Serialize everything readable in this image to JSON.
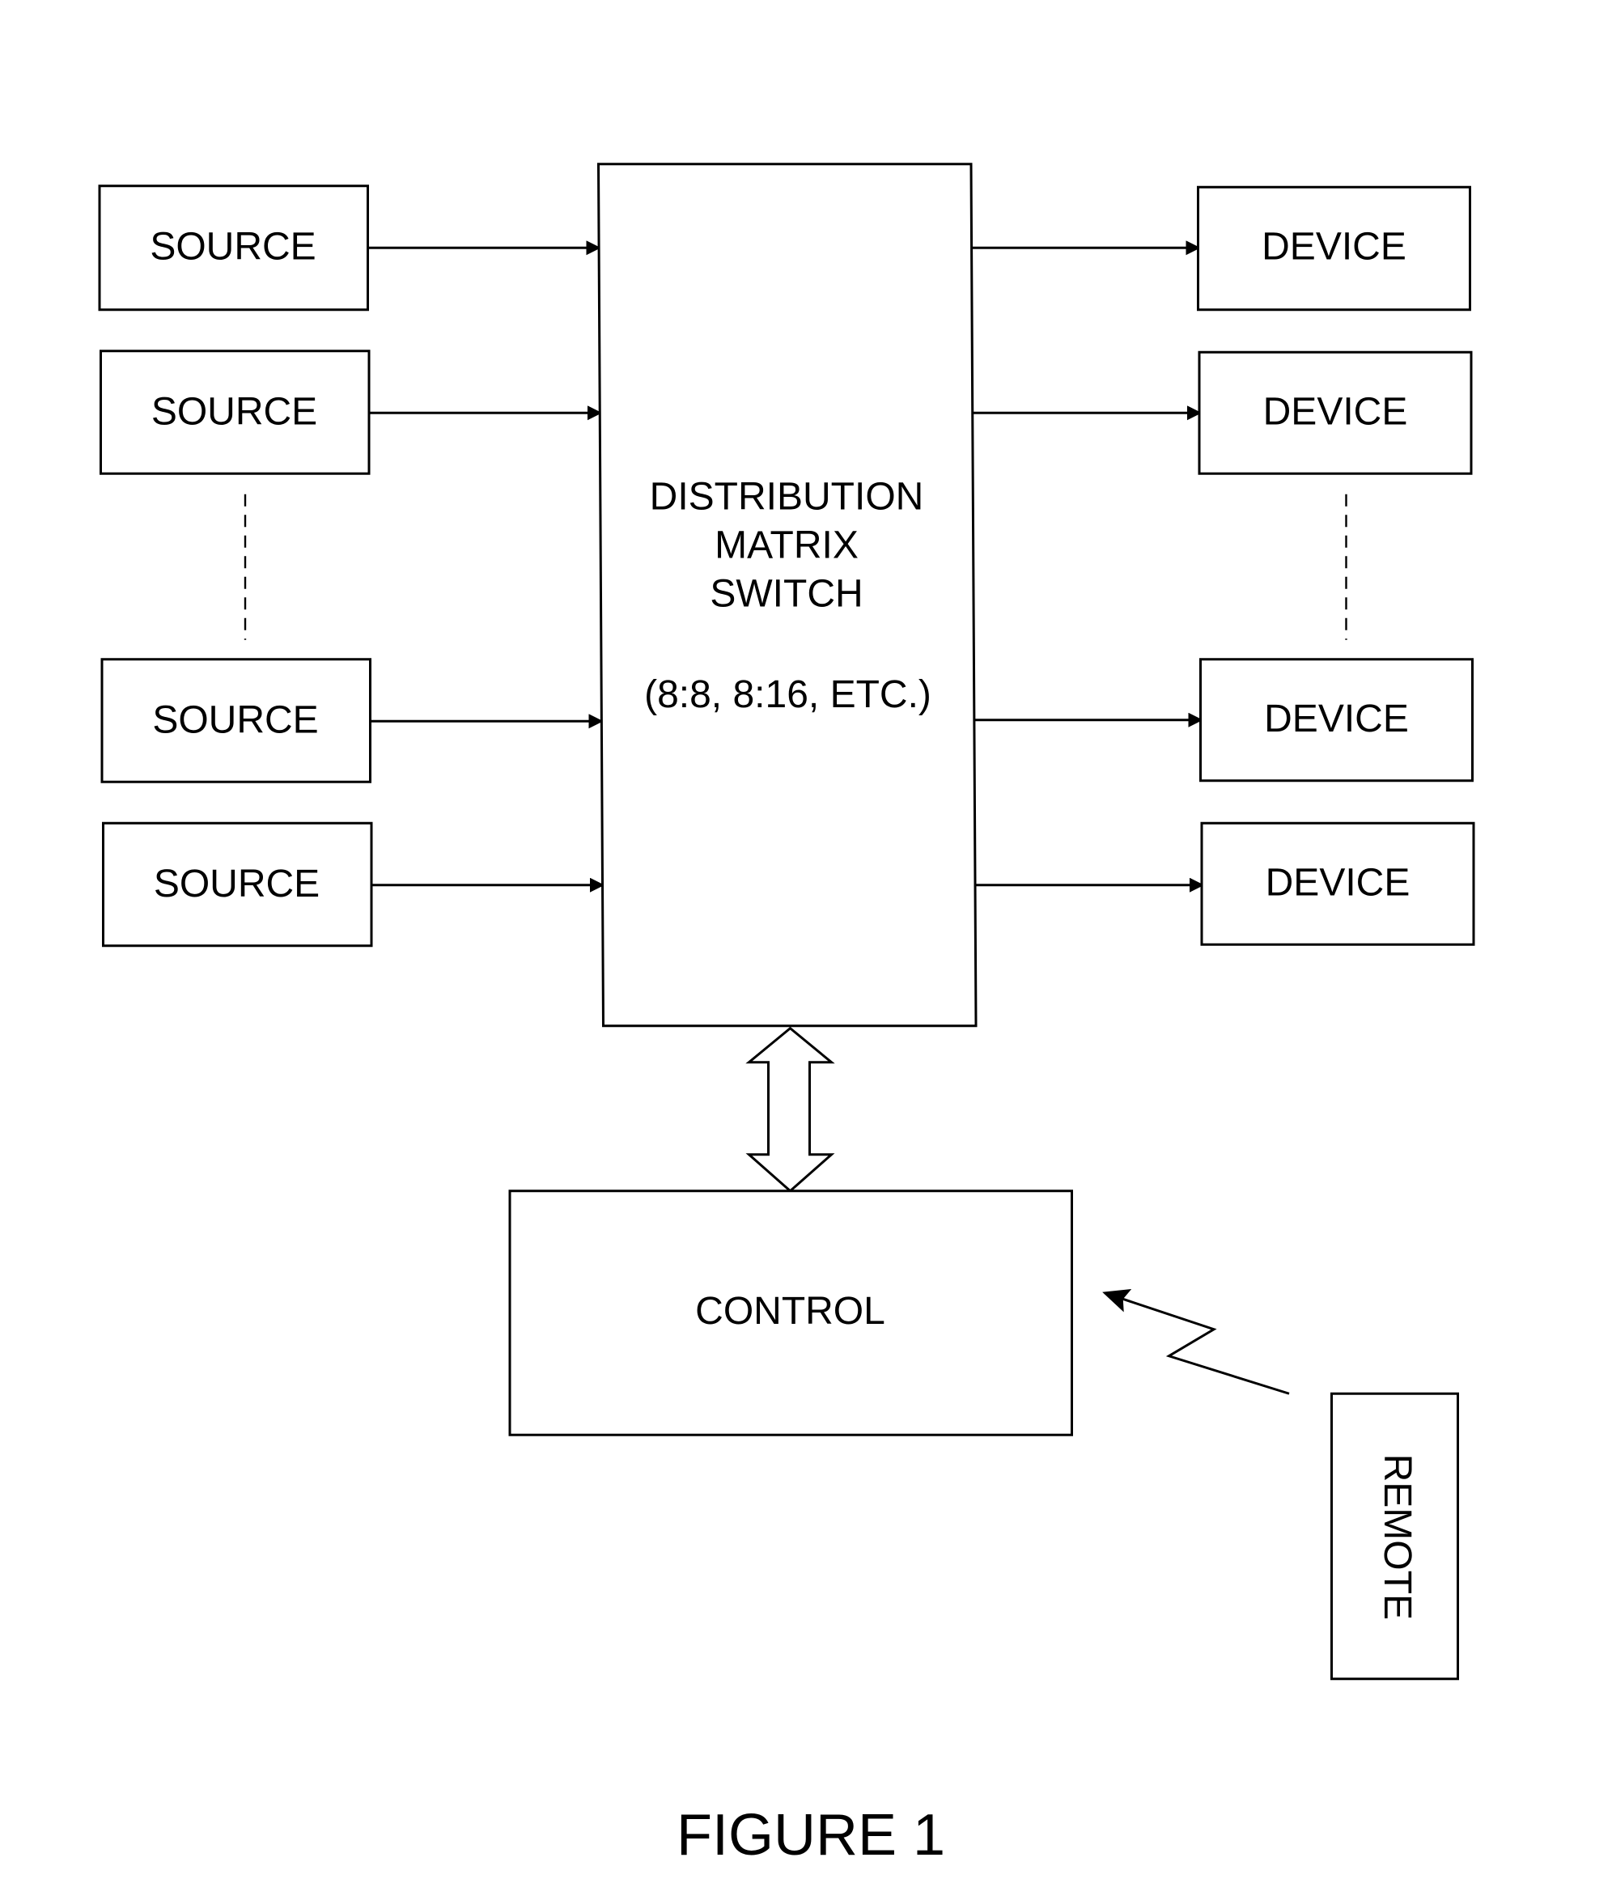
{
  "diagram": {
    "sources": [
      {
        "label": "SOURCE"
      },
      {
        "label": "SOURCE"
      },
      {
        "label": "SOURCE"
      },
      {
        "label": "SOURCE"
      }
    ],
    "devices": [
      {
        "label": "DEVICE"
      },
      {
        "label": "DEVICE"
      },
      {
        "label": "DEVICE"
      },
      {
        "label": "DEVICE"
      }
    ],
    "switch": {
      "lines": [
        "DISTRIBUTION",
        "MATRIX",
        "SWITCH"
      ],
      "ratio": "(8:8, 8:16, ETC.)"
    },
    "control": {
      "label": "CONTROL"
    },
    "remote": {
      "label": "REMOTE"
    },
    "connections": [
      {
        "from": "source-1",
        "to": "switch",
        "type": "arrow"
      },
      {
        "from": "source-2",
        "to": "switch",
        "type": "arrow"
      },
      {
        "from": "source-3",
        "to": "switch",
        "type": "arrow"
      },
      {
        "from": "source-4",
        "to": "switch",
        "type": "arrow"
      },
      {
        "from": "switch",
        "to": "device-1",
        "type": "arrow"
      },
      {
        "from": "switch",
        "to": "device-2",
        "type": "arrow"
      },
      {
        "from": "switch",
        "to": "device-3",
        "type": "arrow"
      },
      {
        "from": "switch",
        "to": "device-4",
        "type": "arrow"
      },
      {
        "from": "switch",
        "to": "control",
        "type": "bidirectional-block-arrow"
      },
      {
        "from": "remote",
        "to": "control",
        "type": "wireless-arrow"
      }
    ],
    "caption": "FIGURE 1"
  }
}
